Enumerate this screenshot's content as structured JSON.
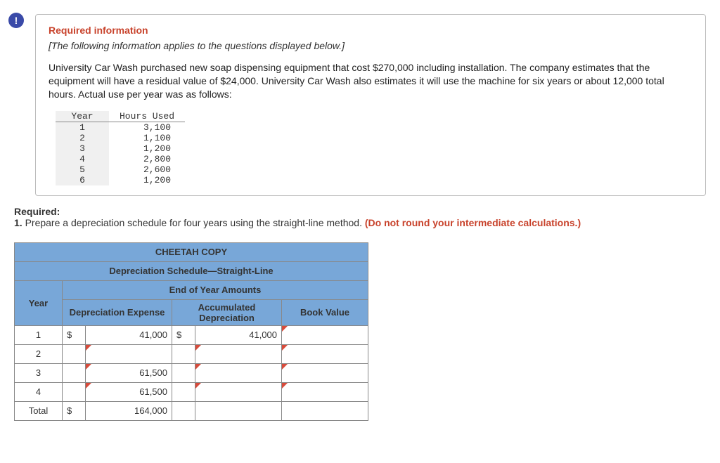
{
  "alert_icon": "!",
  "info": {
    "required_heading": "Required information",
    "italic_note": "[The following information applies to the questions displayed below.]",
    "body_text": "University Car Wash purchased new soap dispensing equipment that cost $270,000 including installation. The company estimates that the equipment will have a residual value of $24,000. University Car Wash also estimates it will use the machine for six years or about 12,000 total hours. Actual use per year was as follows:",
    "hours_headers": [
      "Year",
      "Hours Used"
    ],
    "hours_rows": [
      {
        "year": "1",
        "hours": "3,100"
      },
      {
        "year": "2",
        "hours": "1,100"
      },
      {
        "year": "3",
        "hours": "1,200"
      },
      {
        "year": "4",
        "hours": "2,800"
      },
      {
        "year": "5",
        "hours": "2,600"
      },
      {
        "year": "6",
        "hours": "1,200"
      }
    ]
  },
  "required": {
    "label": "Required:",
    "item_prefix": "1. ",
    "item_text": "Prepare a depreciation schedule for four years using the straight-line method. ",
    "red_note": "(Do not round your intermediate calculations.)"
  },
  "schedule": {
    "title1": "CHEETAH COPY",
    "title2": "Depreciation Schedule—Straight-Line",
    "title3": "End of Year Amounts",
    "col_year": "Year",
    "col_dep": "Depreciation Expense",
    "col_accum": "Accumulated Depreciation",
    "col_book": "Book Value",
    "rows": [
      {
        "year": "1",
        "dep_cur": "$",
        "dep": "41,000",
        "acc_cur": "$",
        "acc": "41,000",
        "book": ""
      },
      {
        "year": "2",
        "dep_cur": "",
        "dep": "",
        "acc_cur": "",
        "acc": "",
        "book": ""
      },
      {
        "year": "3",
        "dep_cur": "",
        "dep": "61,500",
        "acc_cur": "",
        "acc": "",
        "book": ""
      },
      {
        "year": "4",
        "dep_cur": "",
        "dep": "61,500",
        "acc_cur": "",
        "acc": "",
        "book": ""
      },
      {
        "year": "Total",
        "dep_cur": "$",
        "dep": "164,000",
        "acc_cur": "",
        "acc": "",
        "book": ""
      }
    ]
  }
}
